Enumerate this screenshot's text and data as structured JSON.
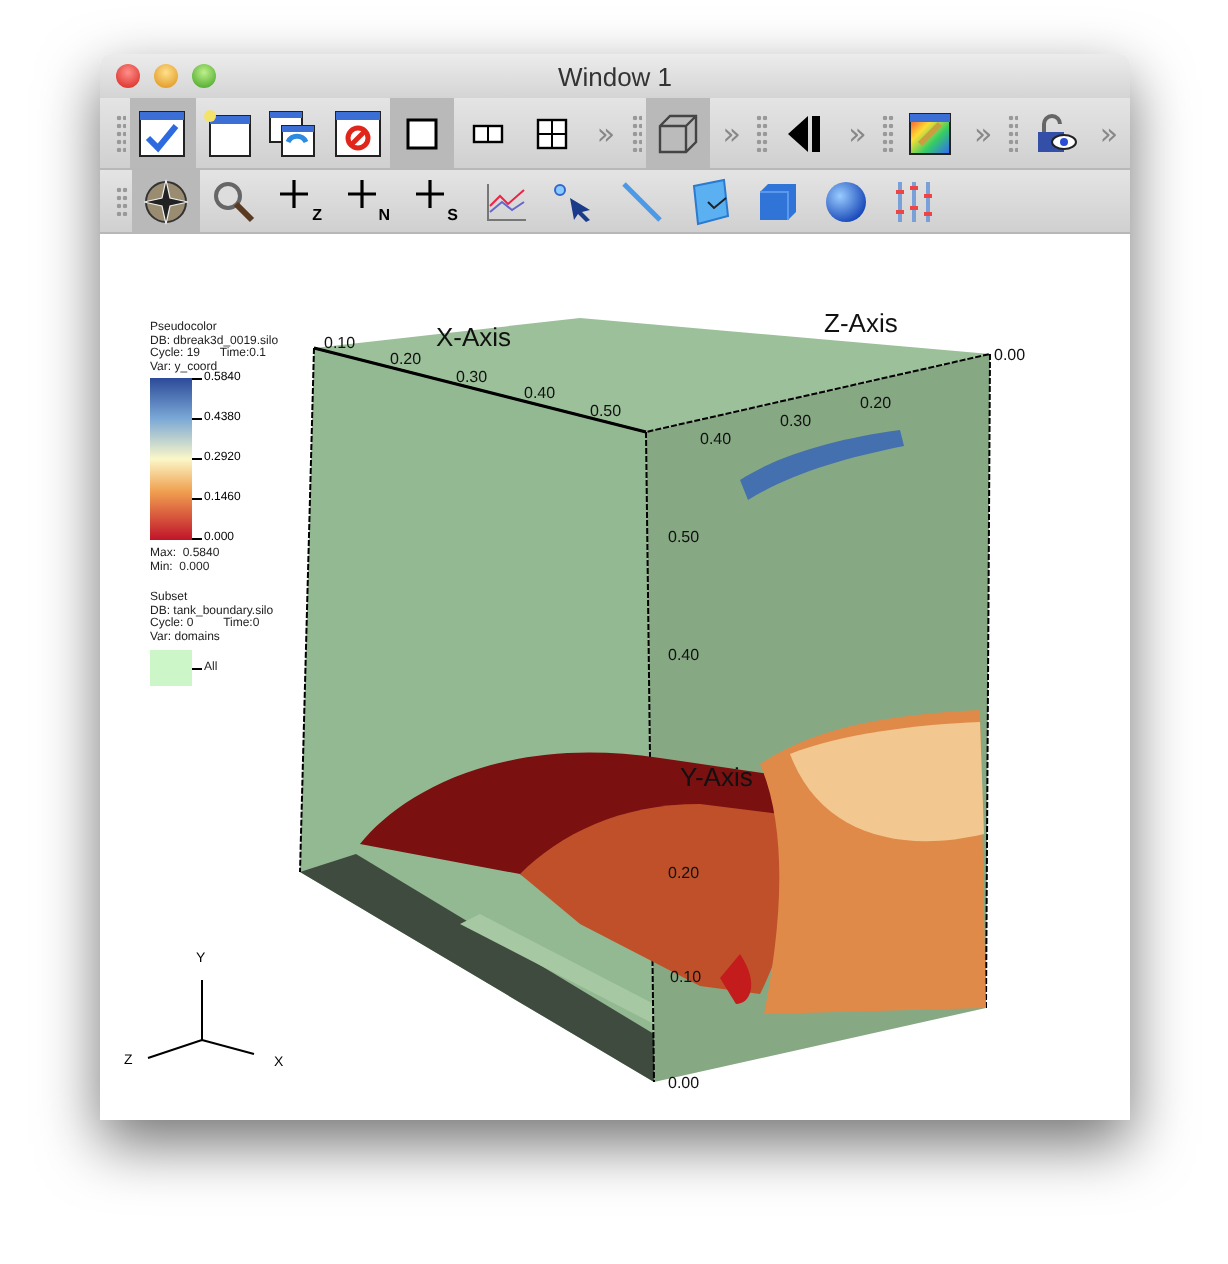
{
  "window": {
    "title": "Window 1"
  },
  "toolbar_top": {
    "groups": [
      {
        "tools": [
          {
            "kind": "apply",
            "pressed": true
          },
          {
            "kind": "new-window",
            "pressed": false
          },
          {
            "kind": "clone-window",
            "pressed": false
          },
          {
            "kind": "delete-window",
            "pressed": false
          },
          {
            "kind": "layout-1",
            "pressed": true
          },
          {
            "kind": "layout-2",
            "pressed": false
          },
          {
            "kind": "layout-4",
            "pressed": false
          }
        ],
        "overflow": "»"
      },
      {
        "tools": [
          {
            "kind": "cube-3d",
            "pressed": true
          }
        ],
        "overflow": "»"
      },
      {
        "tools": [
          {
            "kind": "step-back",
            "pressed": false
          }
        ],
        "overflow": "»"
      },
      {
        "tools": [
          {
            "kind": "color-table",
            "pressed": false
          }
        ],
        "overflow": "»"
      },
      {
        "tools": [
          {
            "kind": "lock",
            "pressed": false
          }
        ],
        "overflow": "»"
      }
    ]
  },
  "toolbar_bottom": {
    "tools": [
      {
        "kind": "navigate",
        "pressed": true
      },
      {
        "kind": "zoom",
        "pressed": false
      },
      {
        "kind": "pick-plus",
        "label": "Z",
        "pressed": false
      },
      {
        "kind": "pick-plus",
        "label": "N",
        "pressed": false
      },
      {
        "kind": "pick-plus",
        "label": "S",
        "pressed": false
      },
      {
        "kind": "curve",
        "pressed": false
      },
      {
        "kind": "pick-arrow",
        "pressed": false
      },
      {
        "kind": "line",
        "pressed": false
      },
      {
        "kind": "plane",
        "pressed": false
      },
      {
        "kind": "box",
        "pressed": false
      },
      {
        "kind": "sphere",
        "pressed": false
      },
      {
        "kind": "parallel-axes",
        "pressed": false
      }
    ]
  },
  "legends": [
    {
      "kind": "colorbar",
      "lines": [
        "Pseudocolor",
        "DB: dbreak3d_0019.silo",
        "Cycle: 19      Time:0.1",
        "Var: y_coord"
      ],
      "ticks": [
        "0.5840",
        "0.4380",
        "0.2920",
        "0.1460",
        "0.000"
      ],
      "max": "Max:  0.5840",
      "min": "Min:  0.000"
    },
    {
      "kind": "subset",
      "lines": [
        "Subset",
        "DB: tank_boundary.silo",
        "Cycle: 0         Time:0",
        "Var: domains"
      ],
      "entries": [
        {
          "label": "All",
          "color": "#ccf5c8"
        }
      ]
    }
  ],
  "plot": {
    "x_axis": {
      "title": "X-Axis",
      "ticks": [
        "0.10",
        "0.20",
        "0.30",
        "0.40",
        "0.50"
      ]
    },
    "z_axis": {
      "title": "Z-Axis",
      "ticks": [
        "0.40",
        "0.30",
        "0.20",
        "0.00"
      ]
    },
    "y_axis": {
      "title": "Y-Axis",
      "ticks": [
        "0.50",
        "0.40",
        "0.20",
        "0.10",
        "0.00"
      ]
    },
    "triad": {
      "y": "Y",
      "z": "Z",
      "x": "X"
    }
  }
}
